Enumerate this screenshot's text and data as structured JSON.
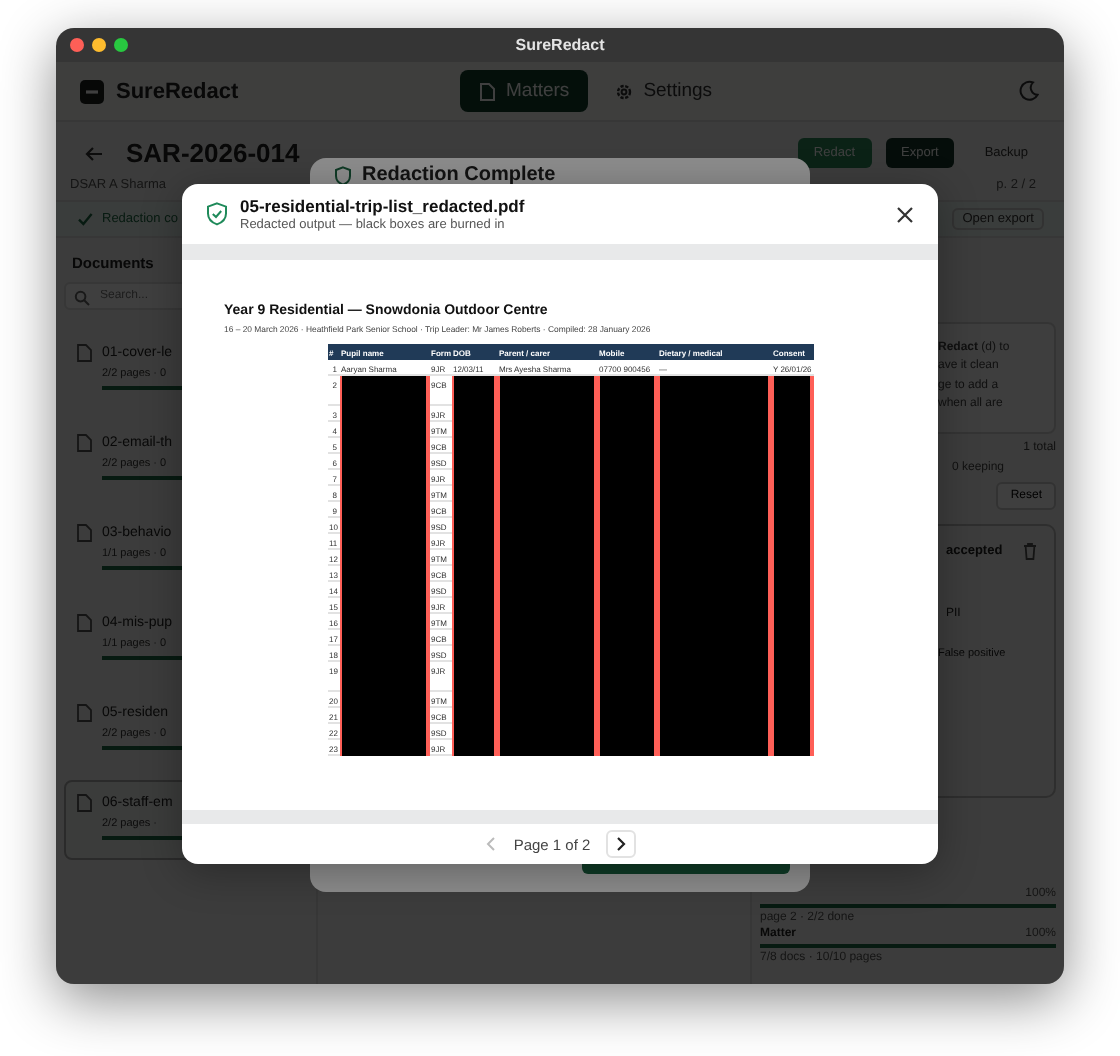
{
  "window": {
    "title": "SureRedact"
  },
  "app_header": {
    "logo": "SureRedact",
    "tabs": [
      {
        "label": "Matters",
        "kind": "matters",
        "selected": true
      },
      {
        "label": "Settings",
        "kind": "settings",
        "selected": false
      }
    ]
  },
  "matter": {
    "title": "SAR-2026-014",
    "subtitle": "DSAR A Sharma",
    "page": "p. 2 / 2",
    "actions": [
      {
        "label": "Redact",
        "kind": "primary"
      },
      {
        "label": "Export",
        "kind": "dark"
      },
      {
        "label": "Backup",
        "kind": "plain"
      }
    ],
    "status": "Redaction co",
    "open_export": "Open export"
  },
  "sidebar": {
    "heading": "Documents",
    "search_placeholder": "Search...",
    "documents": [
      {
        "name": "01-cover-le",
        "meta": "2/2 pages · 0",
        "level": 1,
        "selected": false
      },
      {
        "name": "02-email-th",
        "meta": "2/2 pages · 0",
        "level": 1,
        "selected": false
      },
      {
        "name": "03-behavio",
        "meta": "1/1 pages · 0",
        "level": 1,
        "selected": false
      },
      {
        "name": "04-mis-pup",
        "meta": "1/1 pages · 0",
        "level": 1,
        "selected": false
      },
      {
        "name": "05-residen",
        "meta": "2/2 pages · 0",
        "level": 1,
        "selected": false
      },
      {
        "name": "06-staff-em",
        "meta": "2/2 pages ·",
        "level": 1,
        "selected": true
      }
    ]
  },
  "right_panel": {
    "notice_lines": [
      "**Redact** (d) to",
      "ave it clean",
      "ge to add a",
      "when all are"
    ],
    "total": "1 total",
    "keeping": "0 keeping",
    "reset": "Reset",
    "finding": {
      "status": "accepted",
      "category": "PII",
      "option": "False positive"
    },
    "progress": [
      {
        "percent": "100%",
        "detail": "page 2 · 2/2 done",
        "level": 1
      },
      {
        "label": "Matter",
        "percent": "100%",
        "detail": "7/8 docs · 10/10 pages",
        "level": 1
      }
    ]
  },
  "background_dialog": {
    "title": "Redaction Complete"
  },
  "preview": {
    "filename": "05-residential-trip-list_redacted.pdf",
    "subtitle": "Redacted output — black boxes are burned in",
    "pdf": {
      "title": "Year 9 Residential — Snowdonia Outdoor Centre",
      "meta": "16 – 20 March 2026  ·  Heathfield Park Senior School  ·  Trip Leader: Mr James Roberts  ·  Compiled: 28 January 2026",
      "columns": [
        "#",
        "Pupil name",
        "Form",
        "DOB",
        "Parent / carer",
        "Mobile",
        "Dietary / medical",
        "Consent"
      ],
      "rows": [
        {
          "number": "1",
          "pupil": "Aaryan Sharma",
          "form": "9JR",
          "dob": "12/03/11",
          "parent": "Mrs Ayesha Sharma",
          "mobile": "07700 900456",
          "dietary": "—",
          "consent": "Y 26/01/26",
          "redacted": false,
          "wrapped": false
        },
        {
          "number": "2",
          "form": "9CB",
          "redacted": true,
          "wrapped": true
        },
        {
          "number": "3",
          "form": "9JR",
          "redacted": true,
          "wrapped": false
        },
        {
          "number": "4",
          "form": "9TM",
          "redacted": true,
          "wrapped": false
        },
        {
          "number": "5",
          "form": "9CB",
          "redacted": true,
          "wrapped": false
        },
        {
          "number": "6",
          "form": "9SD",
          "redacted": true,
          "wrapped": false
        },
        {
          "number": "7",
          "form": "9JR",
          "redacted": true,
          "wrapped": false
        },
        {
          "number": "8",
          "form": "9TM",
          "redacted": true,
          "wrapped": false
        },
        {
          "number": "9",
          "form": "9CB",
          "redacted": true,
          "wrapped": false
        },
        {
          "number": "10",
          "form": "9SD",
          "redacted": true,
          "wrapped": false
        },
        {
          "number": "11",
          "form": "9JR",
          "redacted": true,
          "wrapped": false
        },
        {
          "number": "12",
          "form": "9TM",
          "redacted": true,
          "wrapped": false
        },
        {
          "number": "13",
          "form": "9CB",
          "redacted": true,
          "wrapped": false
        },
        {
          "number": "14",
          "form": "9SD",
          "redacted": true,
          "wrapped": false
        },
        {
          "number": "15",
          "form": "9JR",
          "redacted": true,
          "wrapped": false
        },
        {
          "number": "16",
          "form": "9TM",
          "redacted": true,
          "wrapped": false
        },
        {
          "number": "17",
          "form": "9CB",
          "redacted": true,
          "wrapped": false
        },
        {
          "number": "18",
          "form": "9SD",
          "redacted": true,
          "wrapped": false
        },
        {
          "number": "19",
          "form": "9JR",
          "redacted": true,
          "wrapped": true
        },
        {
          "number": "20",
          "form": "9TM",
          "redacted": true,
          "wrapped": false
        },
        {
          "number": "21",
          "form": "9CB",
          "redacted": true,
          "wrapped": false
        },
        {
          "number": "22",
          "form": "9SD",
          "redacted": true,
          "wrapped": false
        },
        {
          "number": "23",
          "form": "9JR",
          "redacted": true,
          "wrapped": false
        }
      ]
    },
    "pager": {
      "label": "Page 1 of 2",
      "prev_disabled": true,
      "next_disabled": false
    }
  }
}
